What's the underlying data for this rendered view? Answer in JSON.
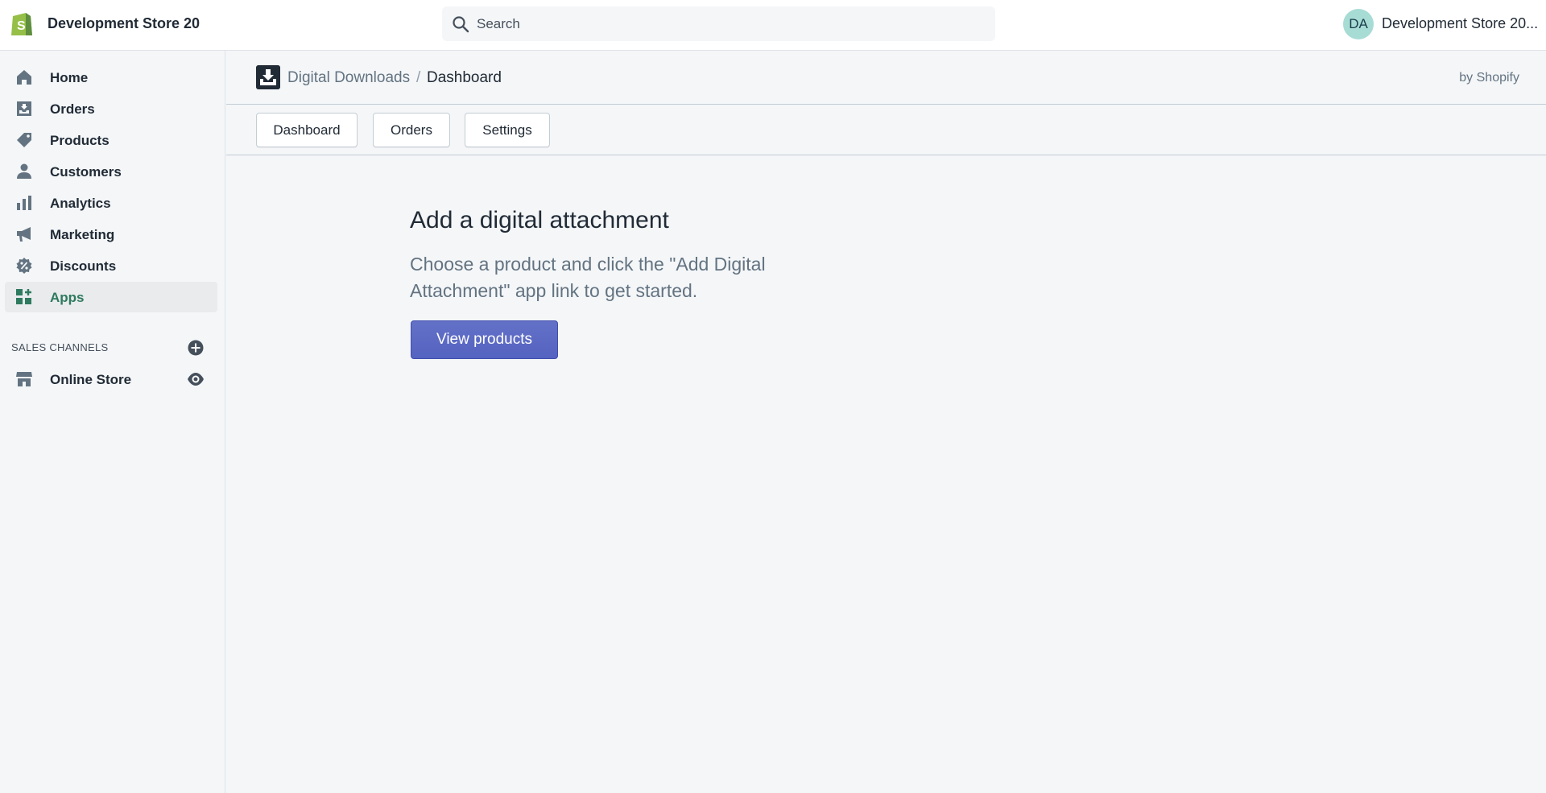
{
  "topbar": {
    "store_name": "Development Store 20",
    "search_placeholder": "Search",
    "avatar_initials": "DA",
    "account_name": "Development Store 20..."
  },
  "sidebar": {
    "items": [
      {
        "label": "Home",
        "icon": "home-icon"
      },
      {
        "label": "Orders",
        "icon": "orders-icon"
      },
      {
        "label": "Products",
        "icon": "tag-icon"
      },
      {
        "label": "Customers",
        "icon": "person-icon"
      },
      {
        "label": "Analytics",
        "icon": "bar-chart-icon"
      },
      {
        "label": "Marketing",
        "icon": "megaphone-icon"
      },
      {
        "label": "Discounts",
        "icon": "discount-icon"
      },
      {
        "label": "Apps",
        "icon": "apps-icon",
        "active": true
      }
    ],
    "sales_channels_title": "SALES CHANNELS",
    "channels": [
      {
        "label": "Online Store",
        "icon": "store-icon"
      }
    ]
  },
  "app_header": {
    "app_name": "Digital Downloads",
    "separator": "/",
    "current_page": "Dashboard",
    "by_line": "by Shopify"
  },
  "tabs": [
    "Dashboard",
    "Orders",
    "Settings"
  ],
  "main": {
    "title": "Add a digital attachment",
    "description": "Choose a product and click the \"Add Digital Attachment\" app link to get started.",
    "primary_button": "View products"
  },
  "colors": {
    "accent": "#5c6ac4",
    "active_nav": "#2e7a5e",
    "logo_green": "#95bf47",
    "avatar_bg": "#a7dcd5"
  }
}
